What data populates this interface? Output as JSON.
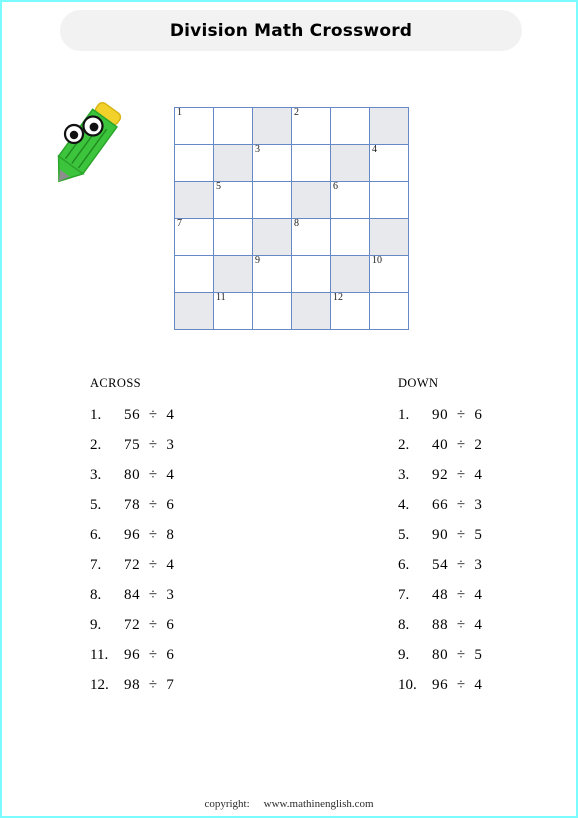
{
  "page": {
    "border_color": "#7afcff",
    "background": "#ffffff"
  },
  "header": {
    "title": "Division Math Crossword",
    "bar_color": "#f2f2f2"
  },
  "mascot": {
    "name": "pencil-character",
    "body_color": "#3dc43d",
    "eraser_color": "#f2d22a",
    "tip_color": "#9b9b9b"
  },
  "grid": {
    "rows": 6,
    "cols": 6,
    "line_color": "#6688c4",
    "shaded_color": "#e7e9ec",
    "cells": [
      [
        {
          "num": "1",
          "shaded": false
        },
        {
          "num": "",
          "shaded": false
        },
        {
          "num": "",
          "shaded": true
        },
        {
          "num": "2",
          "shaded": false
        },
        {
          "num": "",
          "shaded": false
        },
        {
          "num": "",
          "shaded": true
        }
      ],
      [
        {
          "num": "",
          "shaded": false
        },
        {
          "num": "",
          "shaded": true
        },
        {
          "num": "3",
          "shaded": false
        },
        {
          "num": "",
          "shaded": false
        },
        {
          "num": "",
          "shaded": true
        },
        {
          "num": "4",
          "shaded": false
        }
      ],
      [
        {
          "num": "",
          "shaded": true
        },
        {
          "num": "5",
          "shaded": false
        },
        {
          "num": "",
          "shaded": false
        },
        {
          "num": "",
          "shaded": true
        },
        {
          "num": "6",
          "shaded": false
        },
        {
          "num": "",
          "shaded": false
        }
      ],
      [
        {
          "num": "7",
          "shaded": false
        },
        {
          "num": "",
          "shaded": false
        },
        {
          "num": "",
          "shaded": true
        },
        {
          "num": "8",
          "shaded": false
        },
        {
          "num": "",
          "shaded": false
        },
        {
          "num": "",
          "shaded": true
        }
      ],
      [
        {
          "num": "",
          "shaded": false
        },
        {
          "num": "",
          "shaded": true
        },
        {
          "num": "9",
          "shaded": false
        },
        {
          "num": "",
          "shaded": false
        },
        {
          "num": "",
          "shaded": true
        },
        {
          "num": "10",
          "shaded": false
        }
      ],
      [
        {
          "num": "",
          "shaded": true
        },
        {
          "num": "11",
          "shaded": false
        },
        {
          "num": "",
          "shaded": false
        },
        {
          "num": "",
          "shaded": true
        },
        {
          "num": "12",
          "shaded": false
        },
        {
          "num": "",
          "shaded": false
        }
      ]
    ]
  },
  "clues": {
    "across": {
      "heading": "ACROSS",
      "items": [
        {
          "num": "1.",
          "text": "56  ÷  4"
        },
        {
          "num": "2.",
          "text": "75  ÷  3"
        },
        {
          "num": "3.",
          "text": "80  ÷  4"
        },
        {
          "num": "5.",
          "text": "78  ÷  6"
        },
        {
          "num": "6.",
          "text": "96  ÷  8"
        },
        {
          "num": "7.",
          "text": "72  ÷  4"
        },
        {
          "num": "8.",
          "text": "84  ÷  3"
        },
        {
          "num": "9.",
          "text": "72  ÷  6"
        },
        {
          "num": "11.",
          "text": "96  ÷  6"
        },
        {
          "num": "12.",
          "text": "98  ÷  7"
        }
      ]
    },
    "down": {
      "heading": "DOWN",
      "items": [
        {
          "num": "1.",
          "text": "90  ÷  6"
        },
        {
          "num": "2.",
          "text": "40  ÷  2"
        },
        {
          "num": "3.",
          "text": "92  ÷  4"
        },
        {
          "num": "4.",
          "text": "66  ÷  3"
        },
        {
          "num": "5.",
          "text": "90  ÷  5"
        },
        {
          "num": "6.",
          "text": "54  ÷  3"
        },
        {
          "num": "7.",
          "text": "48  ÷  4"
        },
        {
          "num": "8.",
          "text": "88  ÷  4"
        },
        {
          "num": "9.",
          "text": "80  ÷  5"
        },
        {
          "num": "10.",
          "text": "96  ÷  4"
        }
      ]
    }
  },
  "footer": {
    "label": "copyright:",
    "url": "www.mathinenglish.com"
  }
}
